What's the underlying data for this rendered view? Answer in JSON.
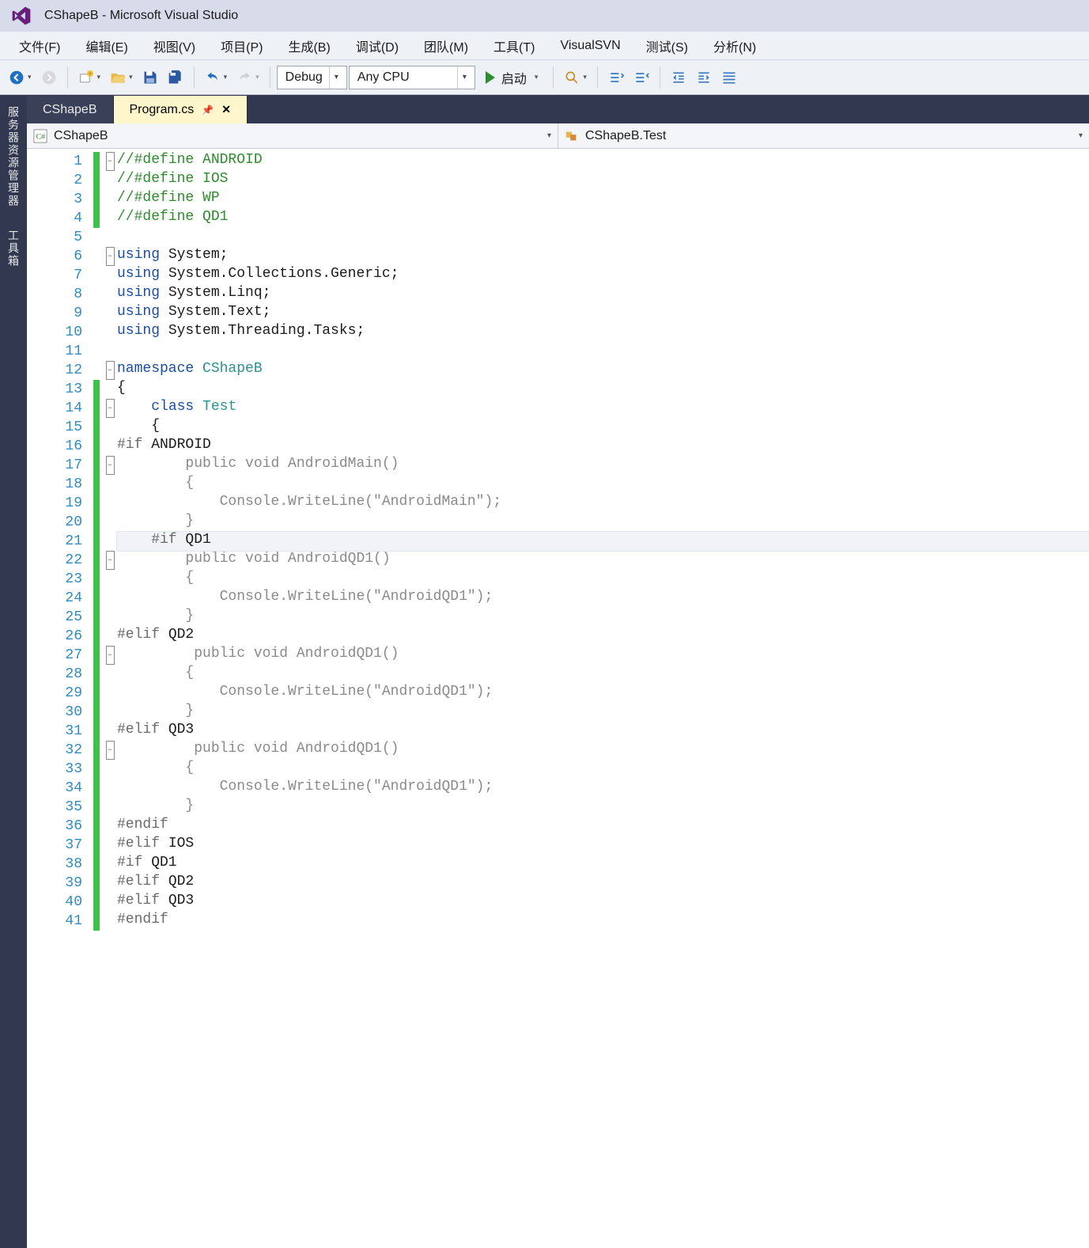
{
  "window": {
    "title": "CShapeB - Microsoft Visual Studio"
  },
  "menu": {
    "items": [
      "文件(F)",
      "编辑(E)",
      "视图(V)",
      "项目(P)",
      "生成(B)",
      "调试(D)",
      "团队(M)",
      "工具(T)",
      "VisualSVN",
      "测试(S)",
      "分析(N)"
    ]
  },
  "toolbar": {
    "config_label": "Debug",
    "platform_label": "Any CPU",
    "start_label": "启动"
  },
  "side_tabs": [
    "服务器资源管理器",
    "工具箱"
  ],
  "doc_tabs": [
    {
      "label": "CShapeB",
      "active": false
    },
    {
      "label": "Program.cs",
      "active": true
    }
  ],
  "nav": {
    "left_label": "CShapeB",
    "right_label": "CShapeB.Test"
  },
  "code": {
    "lines": [
      {
        "n": 1,
        "mark": "green",
        "fold": "-",
        "html": "<span class='tok-cmt'>//#define ANDROID</span>"
      },
      {
        "n": 2,
        "mark": "green",
        "fold": "",
        "html": "<span class='tok-cmt'>//#define IOS</span>"
      },
      {
        "n": 3,
        "mark": "green",
        "fold": "",
        "html": "<span class='tok-cmt'>//#define WP</span>"
      },
      {
        "n": 4,
        "mark": "green",
        "fold": "",
        "html": "<span class='tok-cmt'>//#define QD1</span>"
      },
      {
        "n": 5,
        "mark": "",
        "fold": "",
        "html": ""
      },
      {
        "n": 6,
        "mark": "",
        "fold": "-",
        "html": "<span class='tok-kw'>using</span> System;"
      },
      {
        "n": 7,
        "mark": "",
        "fold": "",
        "html": "<span class='tok-kw'>using</span> System.Collections.Generic;"
      },
      {
        "n": 8,
        "mark": "",
        "fold": "",
        "html": "<span class='tok-kw'>using</span> System.Linq;"
      },
      {
        "n": 9,
        "mark": "",
        "fold": "",
        "html": "<span class='tok-kw'>using</span> System.Text;"
      },
      {
        "n": 10,
        "mark": "",
        "fold": "",
        "html": "<span class='tok-kw'>using</span> System.Threading.Tasks;"
      },
      {
        "n": 11,
        "mark": "",
        "fold": "",
        "html": ""
      },
      {
        "n": 12,
        "mark": "",
        "fold": "-",
        "html": "<span class='tok-kw'>namespace</span> <span class='tok-cls'>CShapeB</span>"
      },
      {
        "n": 13,
        "mark": "green",
        "fold": "",
        "html": "{"
      },
      {
        "n": 14,
        "mark": "green",
        "fold": "-",
        "html": "    <span class='tok-kw'>class</span> <span class='tok-cls'>Test</span>"
      },
      {
        "n": 15,
        "mark": "green",
        "fold": "",
        "html": "    {"
      },
      {
        "n": 16,
        "mark": "green",
        "fold": "",
        "html": "<span class='tok-pre'>#if</span> ANDROID"
      },
      {
        "n": 17,
        "mark": "green",
        "fold": "-",
        "html": "        <span class='tok-gray'>public void AndroidMain()</span>"
      },
      {
        "n": 18,
        "mark": "green",
        "fold": "",
        "html": "        <span class='tok-gray'>{</span>"
      },
      {
        "n": 19,
        "mark": "green",
        "fold": "",
        "html": "            <span class='tok-gray'>Console.WriteLine(\"AndroidMain\");</span>"
      },
      {
        "n": 20,
        "mark": "green",
        "fold": "",
        "html": "        <span class='tok-gray'>}</span>"
      },
      {
        "n": 21,
        "mark": "green",
        "fold": "",
        "html": "    <span class='tok-pre'>#if</span> QD1",
        "current": true
      },
      {
        "n": 22,
        "mark": "green",
        "fold": "-",
        "html": "        <span class='tok-gray'>public void AndroidQD1()</span>"
      },
      {
        "n": 23,
        "mark": "green",
        "fold": "",
        "html": "        <span class='tok-gray'>{</span>"
      },
      {
        "n": 24,
        "mark": "green",
        "fold": "",
        "html": "            <span class='tok-gray'>Console.WriteLine(\"AndroidQD1\");</span>"
      },
      {
        "n": 25,
        "mark": "green",
        "fold": "",
        "html": "        <span class='tok-gray'>}</span>"
      },
      {
        "n": 26,
        "mark": "green",
        "fold": "",
        "html": "<span class='tok-pre'>#elif</span> QD2"
      },
      {
        "n": 27,
        "mark": "green",
        "fold": "-",
        "html": "         <span class='tok-gray'>public void AndroidQD1()</span>"
      },
      {
        "n": 28,
        "mark": "green",
        "fold": "",
        "html": "        <span class='tok-gray'>{</span>"
      },
      {
        "n": 29,
        "mark": "green",
        "fold": "",
        "html": "            <span class='tok-gray'>Console.WriteLine(\"AndroidQD1\");</span>"
      },
      {
        "n": 30,
        "mark": "green",
        "fold": "",
        "html": "        <span class='tok-gray'>}</span>"
      },
      {
        "n": 31,
        "mark": "green",
        "fold": "",
        "html": "<span class='tok-pre'>#elif</span> QD3"
      },
      {
        "n": 32,
        "mark": "green",
        "fold": "-",
        "html": "         <span class='tok-gray'>public void AndroidQD1()</span>"
      },
      {
        "n": 33,
        "mark": "green",
        "fold": "",
        "html": "        <span class='tok-gray'>{</span>"
      },
      {
        "n": 34,
        "mark": "green",
        "fold": "",
        "html": "            <span class='tok-gray'>Console.WriteLine(\"AndroidQD1\");</span>"
      },
      {
        "n": 35,
        "mark": "green",
        "fold": "",
        "html": "        <span class='tok-gray'>}</span>"
      },
      {
        "n": 36,
        "mark": "green",
        "fold": "",
        "html": "<span class='tok-pre'>#endif</span>"
      },
      {
        "n": 37,
        "mark": "green",
        "fold": "",
        "html": "<span class='tok-pre'>#elif</span> IOS"
      },
      {
        "n": 38,
        "mark": "green",
        "fold": "",
        "html": "<span class='tok-pre'>#if</span> QD1"
      },
      {
        "n": 39,
        "mark": "green",
        "fold": "",
        "html": "<span class='tok-pre'>#elif</span> QD2"
      },
      {
        "n": 40,
        "mark": "green",
        "fold": "",
        "html": "<span class='tok-pre'>#elif</span> QD3"
      },
      {
        "n": 41,
        "mark": "green",
        "fold": "",
        "html": "<span class='tok-pre'>#endif</span>"
      }
    ]
  }
}
